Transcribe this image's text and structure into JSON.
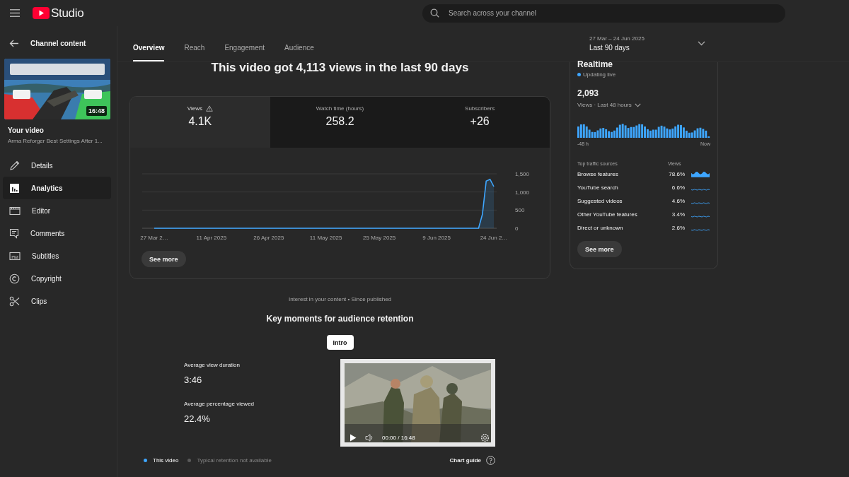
{
  "header": {
    "logo_text": "Studio",
    "search": {
      "placeholder": "Search across your channel"
    }
  },
  "sidebar": {
    "back_label": "Channel content",
    "thumbnail": {
      "kind": "picture",
      "duration": "16:48"
    },
    "video_heading": "Your video",
    "video_title": "Arma Reforger Best Settings After 1...",
    "items": [
      {
        "label": "Details",
        "kind": "pencil",
        "selected": false
      },
      {
        "label": "Analytics",
        "kind": "analytics",
        "selected": true
      },
      {
        "label": "Editor",
        "kind": "editor",
        "selected": false
      },
      {
        "label": "Comments",
        "kind": "comments",
        "selected": false
      },
      {
        "label": "Subtitles",
        "kind": "subtitles",
        "selected": false
      },
      {
        "label": "Copyright",
        "kind": "copyright",
        "selected": false
      },
      {
        "label": "Clips",
        "kind": "scissors",
        "selected": false
      }
    ]
  },
  "tabs": [
    {
      "label": "Overview",
      "selected": true
    },
    {
      "label": "Reach",
      "selected": false
    },
    {
      "label": "Engagement",
      "selected": false
    },
    {
      "label": "Audience",
      "selected": false
    }
  ],
  "date_range": {
    "range": "27 Mar – 24 Jun 2025",
    "label": "Last 90 days"
  },
  "headline": "This video got 4,113 views in the last 90 days",
  "metrics": [
    {
      "label": "Views",
      "value": "4.1K",
      "warning": true,
      "selected": true
    },
    {
      "label": "Watch time (hours)",
      "value": "258.2",
      "warning": false,
      "selected": false
    },
    {
      "label": "Subscribers",
      "value": "+26",
      "warning": false,
      "selected": false
    }
  ],
  "chart_data": {
    "type": "area",
    "categories": [
      "27 Mar 2…",
      null,
      null,
      null,
      null,
      null,
      null,
      null,
      null,
      null,
      null,
      null,
      null,
      null,
      null,
      "11 Apr 2025",
      null,
      null,
      null,
      null,
      null,
      null,
      null,
      null,
      null,
      null,
      null,
      null,
      null,
      null,
      "26 Apr 2025",
      null,
      null,
      null,
      null,
      null,
      null,
      null,
      null,
      null,
      null,
      null,
      null,
      null,
      null,
      "11 May 2025",
      null,
      null,
      null,
      null,
      null,
      null,
      null,
      null,
      null,
      null,
      null,
      null,
      null,
      "25 May 2025",
      null,
      null,
      null,
      null,
      null,
      null,
      null,
      null,
      null,
      null,
      null,
      null,
      null,
      null,
      "9 Jun 2025",
      null,
      null,
      null,
      null,
      null,
      null,
      null,
      null,
      null,
      null,
      null,
      null,
      null,
      null,
      "24 Jun 2…"
    ],
    "series": [
      {
        "color": "#3ea6ff",
        "values": [
          0,
          0,
          0,
          0,
          0,
          0,
          0,
          0,
          0,
          0,
          0,
          0,
          0,
          0,
          0,
          0,
          0,
          0,
          0,
          0,
          0,
          0,
          0,
          0,
          0,
          0,
          0,
          0,
          0,
          0,
          0,
          0,
          0,
          0,
          0,
          0,
          0,
          0,
          0,
          0,
          0,
          0,
          0,
          0,
          0,
          0,
          0,
          0,
          0,
          0,
          0,
          0,
          0,
          0,
          0,
          0,
          0,
          0,
          0,
          0,
          0,
          0,
          0,
          0,
          0,
          0,
          0,
          0,
          0,
          0,
          0,
          0,
          0,
          0,
          0,
          0,
          0,
          0,
          0,
          0,
          0,
          0,
          0,
          0,
          0,
          0,
          380,
          1300,
          1350,
          1150
        ]
      }
    ],
    "ylim": [
      0,
      1500
    ],
    "yticks": [
      {
        "value": 0,
        "label": "0"
      },
      {
        "value": 500,
        "label": "500"
      },
      {
        "value": 1000,
        "label": "1,000"
      },
      {
        "value": 1500,
        "label": "1,500"
      }
    ]
  },
  "see_more": "See more",
  "retention": {
    "subtitle": "Interest in your content • Since published",
    "title": "Key moments for audience retention",
    "chip": "Intro",
    "stats": [
      {
        "label": "Average view duration",
        "value": "3:46"
      },
      {
        "label": "Average percentage viewed",
        "value": "22.4%"
      }
    ],
    "player": {
      "kind": "picture",
      "time": "00:00 / 16:48"
    },
    "legend": [
      {
        "label": "This video",
        "color": "#3ea6ff",
        "available": true
      },
      {
        "label": "Typical retention not available",
        "color": "#5a5a5a",
        "available": false
      }
    ],
    "chart_guide": "Chart guide"
  },
  "realtime": {
    "title": "Realtime",
    "status": "Updating live",
    "count": "2,093",
    "period": "Views · Last 48 hours",
    "axis_start": "-48 h",
    "axis_end": "Now",
    "sources_heading": "Top traffic sources",
    "views_heading": "Views",
    "sources": [
      {
        "name": "Browse features",
        "share": "78.6%"
      },
      {
        "name": "YouTube search",
        "share": "6.6%"
      },
      {
        "name": "Suggested videos",
        "share": "4.6%"
      },
      {
        "name": "Other YouTube features",
        "share": "3.4%"
      },
      {
        "name": "Direct or unknown",
        "share": "2.6%"
      }
    ],
    "see_more": "See more"
  }
}
